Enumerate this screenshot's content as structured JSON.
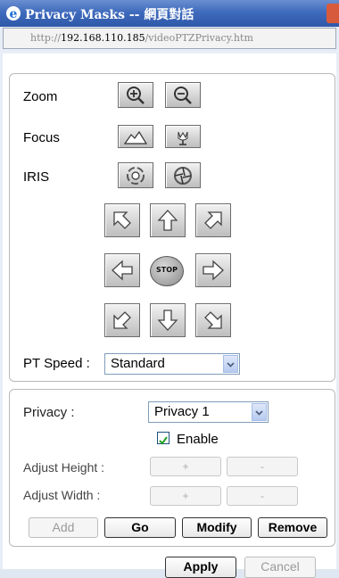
{
  "window": {
    "title": "Privacy Masks -- 網頁對話",
    "url_prefix": "http://",
    "url_host": "192.168.110.185",
    "url_path": "/videoPTZPrivacy.htm"
  },
  "camera": {
    "zoom_label": "Zoom",
    "focus_label": "Focus",
    "iris_label": "IRIS",
    "stop_label": "STOP",
    "pt_speed_label": "PT Speed :",
    "pt_speed_value": "Standard"
  },
  "privacy": {
    "privacy_label": "Privacy :",
    "privacy_value": "Privacy 1",
    "enable_label": "Enable",
    "enable_checked": true,
    "adjust_height_label": "Adjust Height :",
    "adjust_width_label": "Adjust Width :",
    "plus": "+",
    "minus": "-",
    "add_label": "Add",
    "go_label": "Go",
    "modify_label": "Modify",
    "remove_label": "Remove"
  },
  "footer": {
    "apply_label": "Apply",
    "cancel_label": "Cancel"
  },
  "colors": {
    "titlebar": "#3f6bbd",
    "checkbox": "#21a121"
  }
}
